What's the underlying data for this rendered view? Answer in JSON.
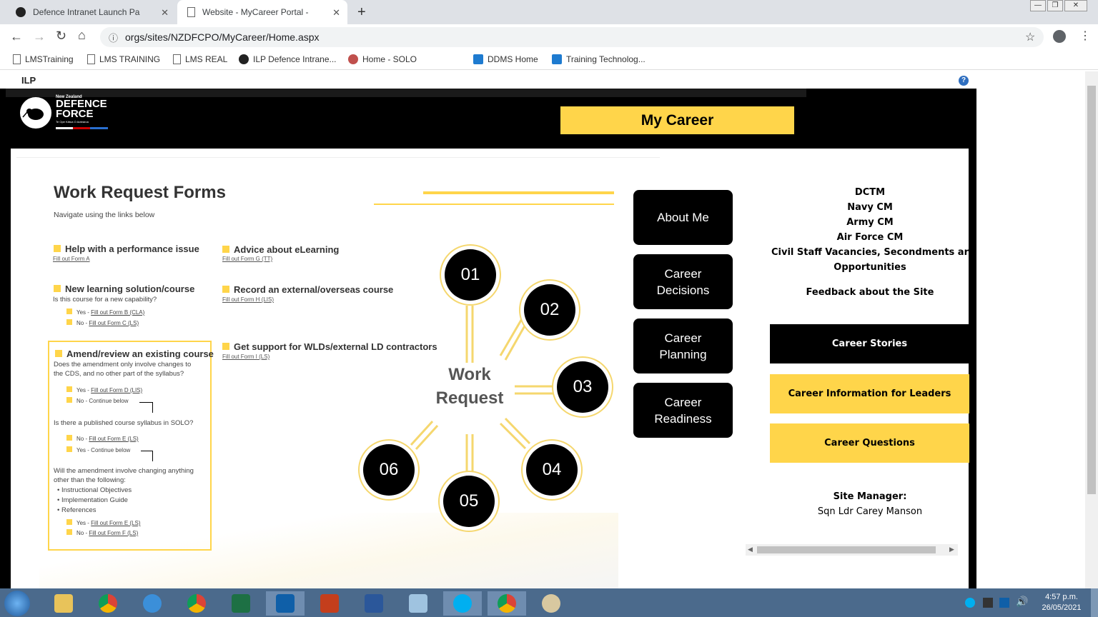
{
  "browser": {
    "tabs": [
      {
        "label": "Defence Intranet Launch Pad"
      },
      {
        "label": "Website - MyCareer Portal - Hom"
      }
    ],
    "url": "orgs/sites/NZDFCPO/MyCareer/Home.aspx",
    "bookmarks": [
      "LMSTraining",
      "LMS TRAINING",
      "LMS REAL",
      "ILP Defence Intrane...",
      "Home - SOLO",
      "DDMS Home",
      "Training Technolog..."
    ]
  },
  "ilp": {
    "label": "ILP"
  },
  "site": {
    "logo": {
      "top": "New Zealand",
      "line1": "DEFENCE",
      "line2": "FORCE",
      "sub": "Te Ope Kātua O Aotearoa"
    },
    "banner": "My Career"
  },
  "forms": {
    "title": "Work Request Forms",
    "subtitle": "Navigate using the links below",
    "help": {
      "title": "Help with a performance issue",
      "link": "Fill out Form A"
    },
    "elearn": {
      "title": "Advice about eLearning",
      "link": "Fill out Form G (TT)"
    },
    "newcourse": {
      "title": "New learning solution/course",
      "q": "Is this course for a new capability?",
      "yes": "Yes - ",
      "yes_link": "Fill out Form B (CLA)",
      "no": "No - ",
      "no_link": "Fill out Form C (LS)"
    },
    "record": {
      "title": "Record an external/overseas course",
      "link": "Fill out Form H (LIS)"
    },
    "support": {
      "title": "Get support for WLDs/external LD contractors",
      "link": "Fill out Form I (LS)"
    },
    "amend": {
      "title": "Amend/review an existing course",
      "q1a": "Does the amendment only involve changes to",
      "q1b": "the CDS, and no other part of the syllabus?",
      "y1": "Yes - ",
      "y1_link": "Fill out Form D (LIS)",
      "n1": "No - Continue below",
      "q2": "Is there a published course syllabus in SOLO?",
      "n2": "No - ",
      "n2_link": "Fill out Form E (LS)",
      "y2": "Yes - Continue below",
      "q3a": "Will the amendment involve changing anything",
      "q3b": "other than the following:",
      "b1": "• Instructional Objectives",
      "b2": "• Implementation Guide",
      "b3": "• References",
      "y3": "Yes - ",
      "y3_link": "Fill out Form E (LS)",
      "n3": "No - ",
      "n3_link": "Fill out Form F (LS)"
    }
  },
  "diagram": {
    "center1": "Work",
    "center2": "Request",
    "nodes": [
      "01",
      "02",
      "03",
      "04",
      "05",
      "06"
    ]
  },
  "nav": [
    {
      "label": "About Me"
    },
    {
      "label": "Career\nDecisions"
    },
    {
      "label": "Career\nPlanning"
    },
    {
      "label": "Career\nReadiness"
    }
  ],
  "right": {
    "links": [
      "DCTM",
      "Navy CM",
      "Army CM",
      "Air Force CM",
      "Civil Staff Vacancies, Secondments ar",
      "Opportunities"
    ],
    "feedback": "Feedback about the Site",
    "stories": "Career Stories",
    "leaders": "Career Information for Leaders",
    "questions": "Career Questions",
    "manager_label": "Site Manager:",
    "manager_name": "Sqn Ldr Carey Manson"
  },
  "clock": {
    "time": "4:57 p.m.",
    "date": "26/05/2021"
  },
  "colors": {
    "accent": "#ffd54a",
    "black": "#000000"
  }
}
